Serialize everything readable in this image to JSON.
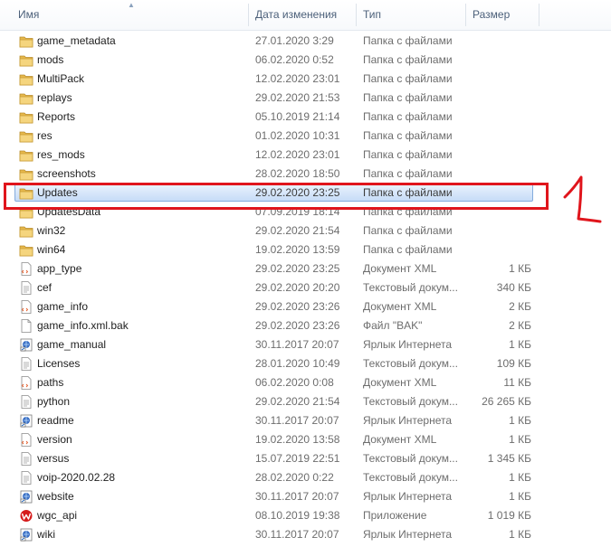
{
  "header": {
    "columns": [
      "Имя",
      "Дата изменения",
      "Тип",
      "Размер"
    ]
  },
  "annotation": {
    "mark": "1",
    "color": "#e0151c"
  },
  "colors": {
    "folder": "#e7b84a",
    "selection": "#c6dcf7",
    "selection_border": "#84acdd"
  },
  "files": [
    {
      "name": "game_metadata",
      "date": "27.01.2020 3:29",
      "type": "Папка с файлами",
      "size": "",
      "icon": "folder-icon"
    },
    {
      "name": "mods",
      "date": "06.02.2020 0:52",
      "type": "Папка с файлами",
      "size": "",
      "icon": "folder-icon"
    },
    {
      "name": "MultiPack",
      "date": "12.02.2020 23:01",
      "type": "Папка с файлами",
      "size": "",
      "icon": "folder-icon"
    },
    {
      "name": "replays",
      "date": "29.02.2020 21:53",
      "type": "Папка с файлами",
      "size": "",
      "icon": "folder-icon"
    },
    {
      "name": "Reports",
      "date": "05.10.2019 21:14",
      "type": "Папка с файлами",
      "size": "",
      "icon": "folder-icon"
    },
    {
      "name": "res",
      "date": "01.02.2020 10:31",
      "type": "Папка с файлами",
      "size": "",
      "icon": "folder-icon"
    },
    {
      "name": "res_mods",
      "date": "12.02.2020 23:01",
      "type": "Папка с файлами",
      "size": "",
      "icon": "folder-icon"
    },
    {
      "name": "screenshots",
      "date": "28.02.2020 18:50",
      "type": "Папка с файлами",
      "size": "",
      "icon": "folder-icon"
    },
    {
      "name": "Updates",
      "date": "29.02.2020 23:25",
      "type": "Папка с файлами",
      "size": "",
      "icon": "folder-icon",
      "selected": true
    },
    {
      "name": "UpdatesData",
      "date": "07.09.2019 18:14",
      "type": "Папка с файлами",
      "size": "",
      "icon": "folder-icon"
    },
    {
      "name": "win32",
      "date": "29.02.2020 21:54",
      "type": "Папка с файлами",
      "size": "",
      "icon": "folder-icon"
    },
    {
      "name": "win64",
      "date": "19.02.2020 13:59",
      "type": "Папка с файлами",
      "size": "",
      "icon": "folder-icon"
    },
    {
      "name": "app_type",
      "date": "29.02.2020 23:25",
      "type": "Документ XML",
      "size": "1 КБ",
      "icon": "xml-file-icon"
    },
    {
      "name": "cef",
      "date": "29.02.2020 20:20",
      "type": "Текстовый докум...",
      "size": "340 КБ",
      "icon": "text-file-icon"
    },
    {
      "name": "game_info",
      "date": "29.02.2020 23:26",
      "type": "Документ XML",
      "size": "2 КБ",
      "icon": "xml-file-icon"
    },
    {
      "name": "game_info.xml.bak",
      "date": "29.02.2020 23:26",
      "type": "Файл \"BAK\"",
      "size": "2 КБ",
      "icon": "file-icon"
    },
    {
      "name": "game_manual",
      "date": "30.11.2017 20:07",
      "type": "Ярлык Интернета",
      "size": "1 КБ",
      "icon": "internet-shortcut-icon"
    },
    {
      "name": "Licenses",
      "date": "28.01.2020 10:49",
      "type": "Текстовый докум...",
      "size": "109 КБ",
      "icon": "text-file-icon"
    },
    {
      "name": "paths",
      "date": "06.02.2020 0:08",
      "type": "Документ XML",
      "size": "11 КБ",
      "icon": "xml-file-icon"
    },
    {
      "name": "python",
      "date": "29.02.2020 21:54",
      "type": "Текстовый докум...",
      "size": "26 265 КБ",
      "icon": "text-file-icon"
    },
    {
      "name": "readme",
      "date": "30.11.2017 20:07",
      "type": "Ярлык Интернета",
      "size": "1 КБ",
      "icon": "internet-shortcut-icon"
    },
    {
      "name": "version",
      "date": "19.02.2020 13:58",
      "type": "Документ XML",
      "size": "1 КБ",
      "icon": "xml-file-icon"
    },
    {
      "name": "versus",
      "date": "15.07.2019 22:51",
      "type": "Текстовый докум...",
      "size": "1 345 КБ",
      "icon": "text-file-icon"
    },
    {
      "name": "voip-2020.02.28",
      "date": "28.02.2020 0:22",
      "type": "Текстовый докум...",
      "size": "1 КБ",
      "icon": "text-file-icon"
    },
    {
      "name": "website",
      "date": "30.11.2017 20:07",
      "type": "Ярлык Интернета",
      "size": "1 КБ",
      "icon": "internet-shortcut-icon"
    },
    {
      "name": "wgc_api",
      "date": "08.10.2019 19:38",
      "type": "Приложение",
      "size": "1 019 КБ",
      "icon": "application-icon"
    },
    {
      "name": "wiki",
      "date": "30.11.2017 20:07",
      "type": "Ярлык Интернета",
      "size": "1 КБ",
      "icon": "internet-shortcut-icon"
    }
  ]
}
